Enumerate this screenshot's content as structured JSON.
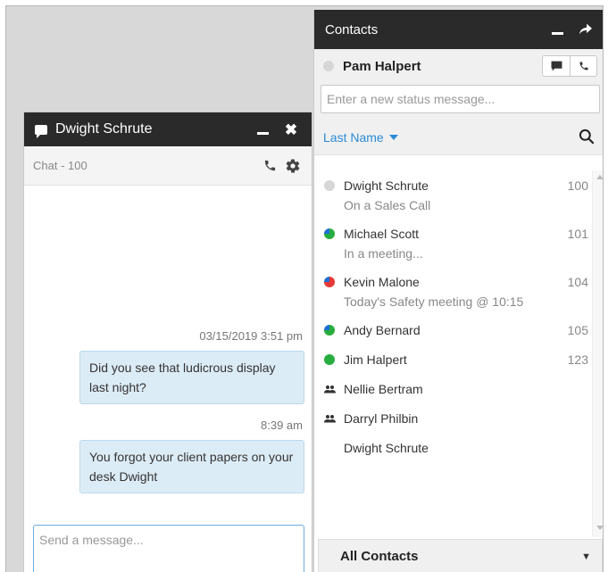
{
  "chat": {
    "title": "Dwight Schrute",
    "subheader": "Chat - 100",
    "messages": [
      {
        "timestamp": "03/15/2019 3:51 pm",
        "text": "Did you see that ludicrous display last night?"
      },
      {
        "timestamp": "8:39 am",
        "text": "You forgot your client papers on your desk Dwight"
      }
    ],
    "compose_placeholder": "Send a message..."
  },
  "contacts": {
    "title": "Contacts",
    "me": {
      "name": "Pam Halpert",
      "presence": "offline"
    },
    "status_placeholder": "Enter a new status message...",
    "sort_label": "Last Name",
    "list": [
      {
        "name": "Dwight Schrute",
        "ext": "100",
        "status": "On a Sales Call",
        "presence": "gray"
      },
      {
        "name": "Michael Scott",
        "ext": "101",
        "status": "In a meeting...",
        "presence": "green-blue"
      },
      {
        "name": "Kevin Malone",
        "ext": "104",
        "status": "Today's Safety meeting @ 10:15",
        "presence": "red-blue"
      },
      {
        "name": "Andy Bernard",
        "ext": "105",
        "status": "",
        "presence": "green-blue"
      },
      {
        "name": "Jim Halpert",
        "ext": "123",
        "status": "",
        "presence": "green"
      },
      {
        "name": "Nellie Bertram",
        "ext": "",
        "status": "",
        "presence": "group"
      },
      {
        "name": "Darryl Philbin",
        "ext": "",
        "status": "",
        "presence": "group"
      },
      {
        "name": "Dwight Schrute",
        "ext": "",
        "status": "",
        "presence": "none"
      }
    ],
    "footer_label": "All Contacts"
  },
  "colors": {
    "header": "#2a2a2a",
    "accent": "#2a8bd6",
    "bubble": "#dcecf6",
    "online": "#27ad3f",
    "busy": "#e63838",
    "mobile": "#1e6ed6"
  }
}
